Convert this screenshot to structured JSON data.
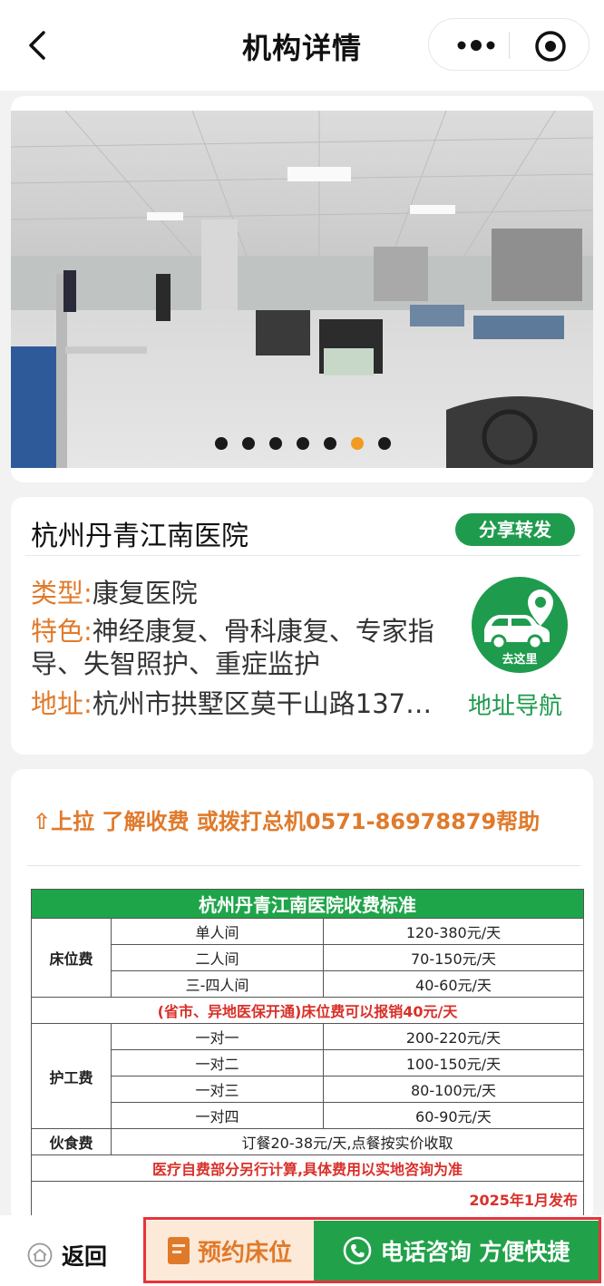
{
  "header": {
    "title": "机构详情"
  },
  "banner": {
    "slide_count": 7,
    "active_slide": 6
  },
  "institution": {
    "name": "杭州丹青江南医院",
    "share_label": "分享转发",
    "type_label": "类型:",
    "type_value": "康复医院",
    "feature_label": "特色:",
    "feature_value": "神经康复、骨科康复、专家指导、失智照护、重症监护",
    "address_label": "地址:",
    "address_value": "杭州市拱墅区莫干山路137…",
    "nav_badge": "去这里",
    "nav_link": "地址导航"
  },
  "fees": {
    "hint": "⇧上拉 了解收费 或拨打总机0571-86978879帮助",
    "table_title": "杭州丹青江南医院收费标准",
    "bed_label": "床位费",
    "bed_rows": [
      {
        "item": "单人间",
        "price": "120-380元/天"
      },
      {
        "item": "二人间",
        "price": "70-150元/天"
      },
      {
        "item": "三-四人间",
        "price": "40-60元/天"
      }
    ],
    "bed_note": "(省市、异地医保开通)床位费可以报销40元/天",
    "care_label": "护工费",
    "care_rows": [
      {
        "item": "一对一",
        "price": "200-220元/天"
      },
      {
        "item": "一对二",
        "price": "100-150元/天"
      },
      {
        "item": "一对三",
        "price": "80-100元/天"
      },
      {
        "item": "一对四",
        "price": "60-90元/天"
      }
    ],
    "meal_label": "伙食费",
    "meal_value": "订餐20-38元/天,点餐按实价收取",
    "medical_note": "医疗自费部分另行计算,具体费用以实地咨询为准",
    "published": "2025年1月发布"
  },
  "bottom_bar": {
    "home_label": "返回",
    "book_label": "预约床位",
    "call_label": "电话咨询 方便快捷"
  },
  "colors": {
    "brand_green": "#1f9b4e",
    "accent_orange": "#e07a2b",
    "alert_red": "#d9302a",
    "highlight_red": "#e8333a"
  }
}
